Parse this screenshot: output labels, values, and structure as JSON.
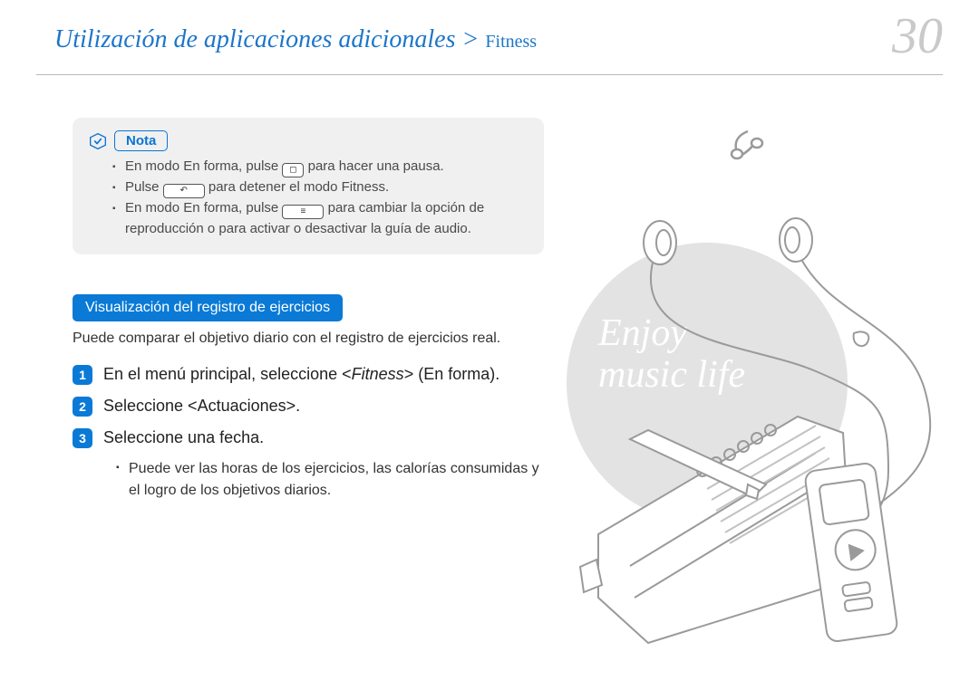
{
  "header": {
    "breadcrumb_main": "Utilización de aplicaciones adicionales",
    "breadcrumb_sep": " > ",
    "breadcrumb_sub": "Fitness",
    "page_number": "30"
  },
  "note": {
    "badge": "Nota",
    "items": [
      {
        "pre": "En modo En forma, pulse ",
        "btn": "◻",
        "btn_class": "",
        "post": " para hacer una pausa."
      },
      {
        "pre": "Pulse ",
        "btn": "↶",
        "btn_class": "wide",
        "post": " para detener el modo Fitness."
      },
      {
        "pre": "En modo En forma, pulse ",
        "btn": "≡",
        "btn_class": "wide",
        "post": " para cambiar la opción de reproducción o para activar o desactivar la guía de audio."
      }
    ]
  },
  "section": {
    "title": "Visualización del registro de ejercicios",
    "desc": "Puede comparar el objetivo diario con el registro de ejercicios real."
  },
  "steps": [
    {
      "n": "1",
      "text_pre": "En el menú principal, seleccione <",
      "text_ital": "Fitness",
      "text_post": "> (En forma)."
    },
    {
      "n": "2",
      "text_pre": "Seleccione <Actuaciones>.",
      "text_ital": "",
      "text_post": ""
    },
    {
      "n": "3",
      "text_pre": "Seleccione una fecha.",
      "text_ital": "",
      "text_post": ""
    }
  ],
  "step3_sub": [
    "Puede ver las horas de los ejercicios, las calorías consumidas y el logro de los objetivos diarios."
  ],
  "illustration": {
    "slogan_line1": "Enjoy",
    "slogan_line2": "music life"
  }
}
